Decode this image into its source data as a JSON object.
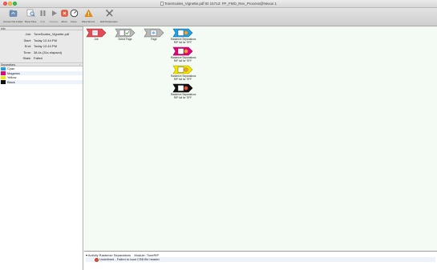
{
  "window": {
    "title": "ToneScales_Vignette.pdf ID 15713: FP_FMD_Rev_Process@Nexus 1"
  },
  "toolbar": {
    "items": [
      {
        "label": "Access File Folder"
      },
      {
        "label": "Show Files"
      },
      {
        "label": "Hold"
      },
      {
        "label": "Release"
      },
      {
        "label": "Abort"
      },
      {
        "label": "Done"
      },
      {
        "label": "Show Errors"
      },
      {
        "label": "Edit Parameters"
      }
    ]
  },
  "info": {
    "header": "Info",
    "job_key": "Job:",
    "job": "ToneScales_Vignette.pdf",
    "start_key": "Start:",
    "start": "Today 12:44 PM",
    "end_key": "End:",
    "end": "Today 12:44 PM",
    "time_key": "Time:",
    "time": "38.4s (31s elapsed)",
    "state_key": "State:",
    "state": "Failed"
  },
  "separations": {
    "header": "Separations",
    "items": [
      {
        "name": "Cyan",
        "color": "#1fa0e6"
      },
      {
        "name": "Magenta",
        "color": "#e6007e"
      },
      {
        "name": "Yellow",
        "color": "#f3e600"
      },
      {
        "name": "Black",
        "color": "#111111"
      }
    ]
  },
  "workflow": {
    "nodes": [
      {
        "label": "Job"
      },
      {
        "label": "Select Page"
      },
      {
        "label": "Page"
      },
      {
        "label": "Rasterize Separations",
        "sub": "RIP full for TIFF",
        "accent": "#1fa0e6"
      },
      {
        "label": "Rasterize Separations",
        "sub": "RIP full for TIFF",
        "accent": "#e6007e"
      },
      {
        "label": "Rasterize Separations",
        "sub": "RIP full for TIFF",
        "accent": "#f3e600"
      },
      {
        "label": "Rasterize Separations",
        "sub": "RIP full for TIFF",
        "accent": "#111111"
      }
    ]
  },
  "status": {
    "activity": "Activity Rasterize Separations",
    "module": "Module:  ToneRIP",
    "message": "Undefined - Failed to load CSB file header"
  }
}
